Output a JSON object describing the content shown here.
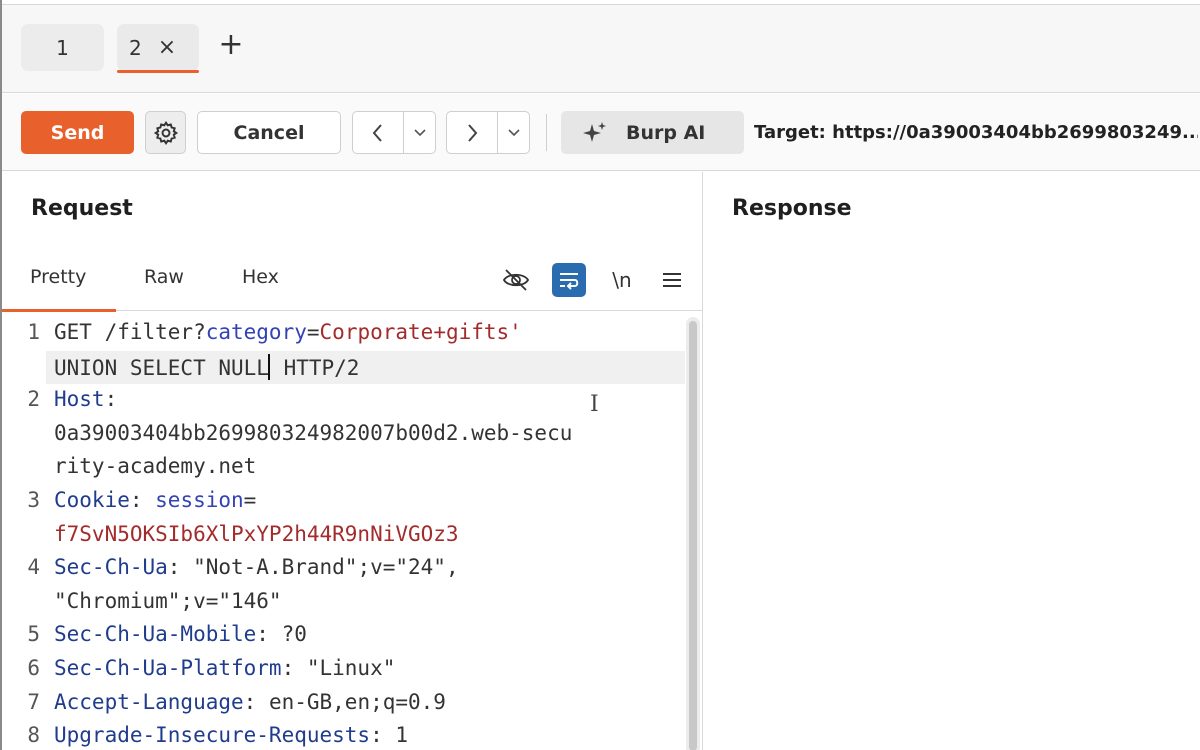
{
  "tabs": [
    {
      "label": "1"
    },
    {
      "label": "2"
    }
  ],
  "tab_close_icon": "close-icon",
  "tab_add_icon": "plus-icon",
  "toolbar": {
    "send_label": "Send",
    "cancel_label": "Cancel",
    "burp_ai_label": "Burp AI",
    "target_text": "Target: https://0a39003404bb2699803249..."
  },
  "request": {
    "title": "Request",
    "subtabs": [
      "Pretty",
      "Raw",
      "Hex"
    ],
    "newline_toggle": "\\n"
  },
  "response": {
    "title": "Response"
  },
  "colors": {
    "accent": "#e8612c",
    "header_key": "#203c8c",
    "value_red": "#a32b2b",
    "value_blue": "#3343b5",
    "wrap_active": "#2a6cb0"
  },
  "code_lines": [
    {
      "num": "1",
      "parts": [
        {
          "t": "GET /filter?",
          "c": ""
        },
        {
          "t": "category",
          "c": "val-blue"
        },
        {
          "t": "=",
          "c": ""
        },
        {
          "t": "Corporate+gifts'",
          "c": "val-red"
        }
      ]
    },
    {
      "num": "",
      "parts": [
        {
          "t": "UNION SELECT NULL",
          "c": ""
        },
        {
          "t": "",
          "c": "caret"
        },
        {
          "t": " HTTP/2",
          "c": ""
        }
      ]
    },
    {
      "num": "2",
      "parts": [
        {
          "t": "Host",
          "c": "key"
        },
        {
          "t": ":",
          "c": ""
        }
      ]
    },
    {
      "num": "",
      "parts": [
        {
          "t": "0a39003404bb26998032498​2007b00d2.web-secu",
          "c": ""
        }
      ]
    },
    {
      "num": "",
      "parts": [
        {
          "t": "rity-academy.net",
          "c": ""
        }
      ]
    },
    {
      "num": "3",
      "parts": [
        {
          "t": "Cookie",
          "c": "key"
        },
        {
          "t": ": ",
          "c": ""
        },
        {
          "t": "session",
          "c": "val-blue"
        },
        {
          "t": "=",
          "c": ""
        }
      ]
    },
    {
      "num": "",
      "parts": [
        {
          "t": "f7SvN5OKSIb6XlPxYP2h44R9nNiVGOz3",
          "c": "val-red"
        }
      ]
    },
    {
      "num": "4",
      "parts": [
        {
          "t": "Sec-Ch-Ua",
          "c": "key"
        },
        {
          "t": ": \"Not-A.Brand\";v=\"24\",",
          "c": ""
        }
      ]
    },
    {
      "num": "",
      "parts": [
        {
          "t": "\"Chromium\";v=\"146\"",
          "c": ""
        }
      ]
    },
    {
      "num": "5",
      "parts": [
        {
          "t": "Sec-Ch-Ua-Mobile",
          "c": "key"
        },
        {
          "t": ": ?0",
          "c": ""
        }
      ]
    },
    {
      "num": "6",
      "parts": [
        {
          "t": "Sec-Ch-Ua-Platform",
          "c": "key"
        },
        {
          "t": ": \"Linux\"",
          "c": ""
        }
      ]
    },
    {
      "num": "7",
      "parts": [
        {
          "t": "Accept-Language",
          "c": "key"
        },
        {
          "t": ": en-GB,en;q=0.9",
          "c": ""
        }
      ]
    },
    {
      "num": "8",
      "parts": [
        {
          "t": "Upgrade-Insecure-Requests",
          "c": "key"
        },
        {
          "t": ": 1",
          "c": ""
        }
      ]
    }
  ]
}
